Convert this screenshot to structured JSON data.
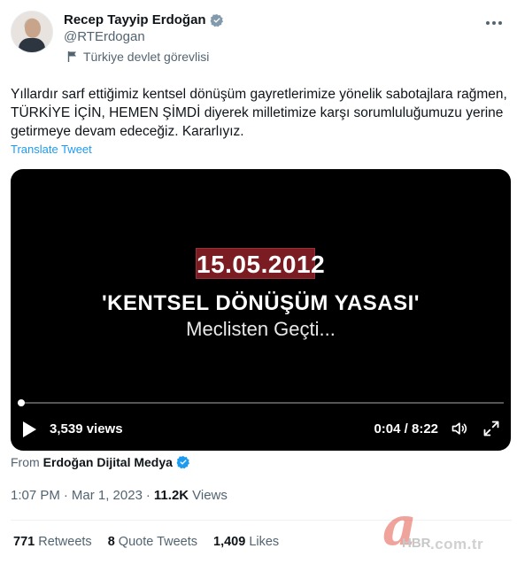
{
  "user": {
    "display_name": "Recep Tayyip Erdoğan",
    "handle": "@RTErdogan",
    "label": "Türkiye devlet görevlisi"
  },
  "tweet": {
    "text": "Yıllardır sarf ettiğimiz kentsel dönüşüm gayretlerimize yönelik sabotajlara rağmen, TÜRKİYE İÇİN, HEMEN ŞİMDİ diyerek milletimize karşı sorumluluğumuzu yerine getirmeye devam edeceğiz. Kararlıyız.",
    "translate_label": "Translate Tweet"
  },
  "video": {
    "date_text": "15.05.2012",
    "title": "'KENTSEL DÖNÜŞÜM YASASI'",
    "subtitle": "Meclisten Geçti...",
    "views_label": "3,539 views",
    "time_label": "0:04 / 8:22",
    "progress_fraction": 0.008
  },
  "source": {
    "prefix": "From",
    "name": "Erdoğan Dijital Medya"
  },
  "meta": {
    "time": "1:07 PM",
    "separator": "·",
    "date": "Mar 1, 2023",
    "views_count": "11.2K",
    "views_label": "Views"
  },
  "stats": {
    "retweets_count": "771",
    "retweets_label": "Retweets",
    "quotes_count": "8",
    "quotes_label": "Quote Tweets",
    "likes_count": "1,409",
    "likes_label": "Likes"
  },
  "watermark": {
    "brand": "HBR",
    "domain": ".com.tr"
  },
  "colors": {
    "accent": "#1d9bf0",
    "date_box": "#7a1c22"
  },
  "icons": [
    "verified-icon",
    "flag-icon",
    "more-icon",
    "play-icon",
    "volume-icon",
    "fullscreen-icon"
  ]
}
